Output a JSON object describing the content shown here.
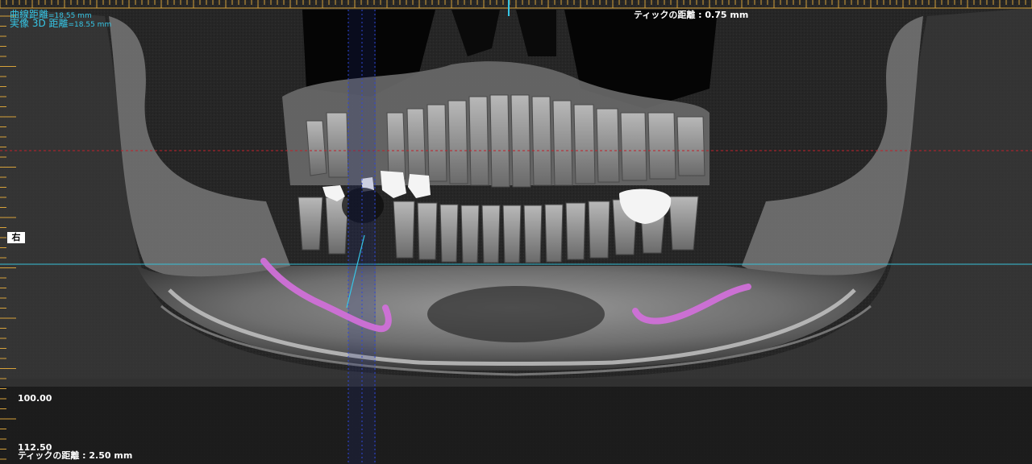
{
  "measurements": {
    "curve_label": "曲線距離",
    "curve_value": "=18.55 mm",
    "real3d_label": "実像 3D 距離",
    "real3d_value": "=18.55 mm"
  },
  "tick_distance_top": "ティックの距離 : 0.75 mm",
  "tick_distance_bottom": "ティックの距離 : 2.50 mm",
  "ruler": {
    "label_100": "100.00",
    "label_112": "112.50"
  },
  "side_marker": "右",
  "colors": {
    "background": "#000000",
    "ruler_tick": "#d7a23a",
    "measure_text": "#36c6e6",
    "horizontal_red_line": "#c0202a",
    "horizontal_cyan_line": "#38c0d8",
    "slice_blue_line": "#3048d8",
    "nerve_canal_trace": "#d070d8"
  },
  "icons": {
    "panorama": "dental-panoramic-xray",
    "nerve_trace": "mandibular-canal-trace"
  }
}
